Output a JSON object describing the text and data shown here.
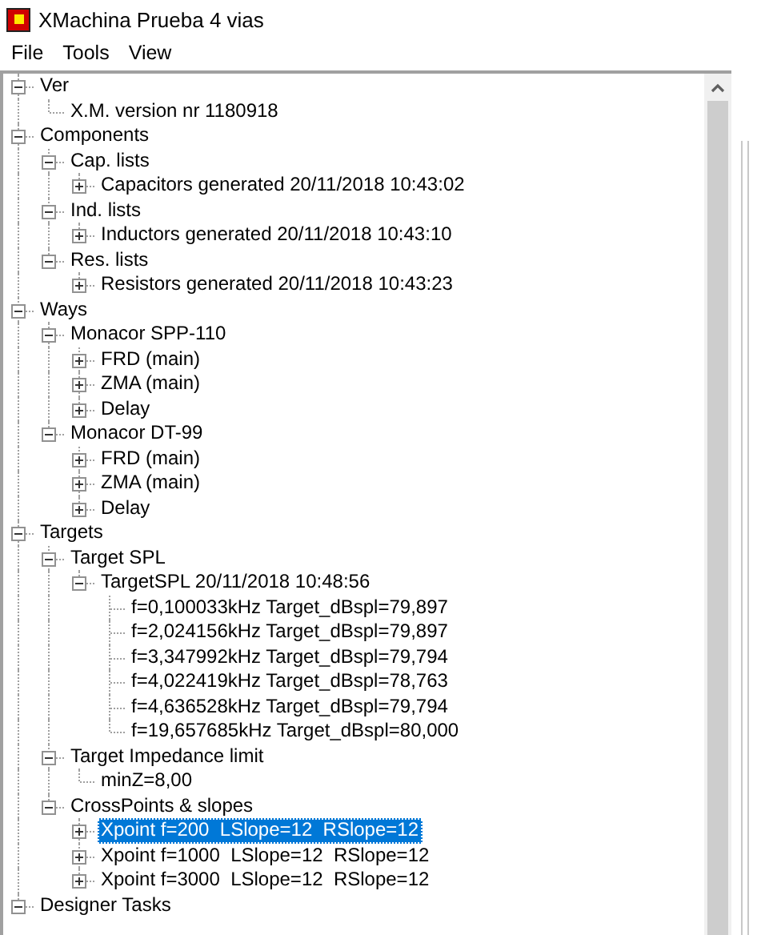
{
  "window": {
    "title": "XMachina Prueba 4 vias"
  },
  "menu": [
    {
      "label": "File"
    },
    {
      "label": "Tools"
    },
    {
      "label": "View"
    }
  ],
  "tree": [
    {
      "label": "Ver",
      "expanded": true,
      "selected": false,
      "children": [
        {
          "label": "X.M. version nr 1180918",
          "selected": false
        }
      ]
    },
    {
      "label": "Components",
      "expanded": true,
      "selected": false,
      "children": [
        {
          "label": "Cap. lists",
          "expanded": true,
          "selected": false,
          "children": [
            {
              "label": "Capacitors generated 20/11/2018 10:43:02",
              "expanded": false,
              "selected": false
            }
          ]
        },
        {
          "label": "Ind. lists",
          "expanded": true,
          "selected": false,
          "children": [
            {
              "label": "Inductors generated 20/11/2018 10:43:10",
              "expanded": false,
              "selected": false
            }
          ]
        },
        {
          "label": "Res. lists",
          "expanded": true,
          "selected": false,
          "children": [
            {
              "label": "Resistors generated 20/11/2018 10:43:23",
              "expanded": false,
              "selected": false
            }
          ]
        }
      ]
    },
    {
      "label": "Ways",
      "expanded": true,
      "selected": false,
      "children": [
        {
          "label": "Monacor SPP-110",
          "expanded": true,
          "selected": false,
          "children": [
            {
              "label": "FRD (main)",
              "expanded": false,
              "selected": false
            },
            {
              "label": "ZMA (main)",
              "expanded": false,
              "selected": false
            },
            {
              "label": "Delay",
              "expanded": false,
              "selected": false
            }
          ]
        },
        {
          "label": "Monacor DT-99",
          "expanded": true,
          "selected": false,
          "children": [
            {
              "label": "FRD (main)",
              "expanded": false,
              "selected": false
            },
            {
              "label": "ZMA (main)",
              "expanded": false,
              "selected": false
            },
            {
              "label": "Delay",
              "expanded": false,
              "selected": false
            }
          ]
        }
      ]
    },
    {
      "label": "Targets",
      "expanded": true,
      "selected": false,
      "children": [
        {
          "label": "Target SPL",
          "expanded": true,
          "selected": false,
          "children": [
            {
              "label": "TargetSPL 20/11/2018 10:48:56",
              "expanded": true,
              "selected": false,
              "children": [
                {
                  "label": "f=0,100033kHz Target_dBspl=79,897",
                  "selected": false
                },
                {
                  "label": "f=2,024156kHz Target_dBspl=79,897",
                  "selected": false
                },
                {
                  "label": "f=3,347992kHz Target_dBspl=79,794",
                  "selected": false
                },
                {
                  "label": "f=4,022419kHz Target_dBspl=78,763",
                  "selected": false
                },
                {
                  "label": "f=4,636528kHz Target_dBspl=79,794",
                  "selected": false
                },
                {
                  "label": "f=19,657685kHz Target_dBspl=80,000",
                  "selected": false
                }
              ]
            }
          ]
        },
        {
          "label": "Target Impedance limit",
          "expanded": true,
          "selected": false,
          "children": [
            {
              "label": "minZ=8,00",
              "selected": false
            }
          ]
        },
        {
          "label": "CrossPoints & slopes",
          "expanded": true,
          "selected": false,
          "children": [
            {
              "label": "Xpoint f=200  LSlope=12  RSlope=12",
              "expanded": false,
              "selected": true
            },
            {
              "label": "Xpoint f=1000  LSlope=12  RSlope=12",
              "expanded": false,
              "selected": false
            },
            {
              "label": "Xpoint f=3000  LSlope=12  RSlope=12",
              "expanded": false,
              "selected": false
            }
          ]
        }
      ]
    },
    {
      "label": "Designer Tasks",
      "expanded": true,
      "selected": false
    }
  ]
}
